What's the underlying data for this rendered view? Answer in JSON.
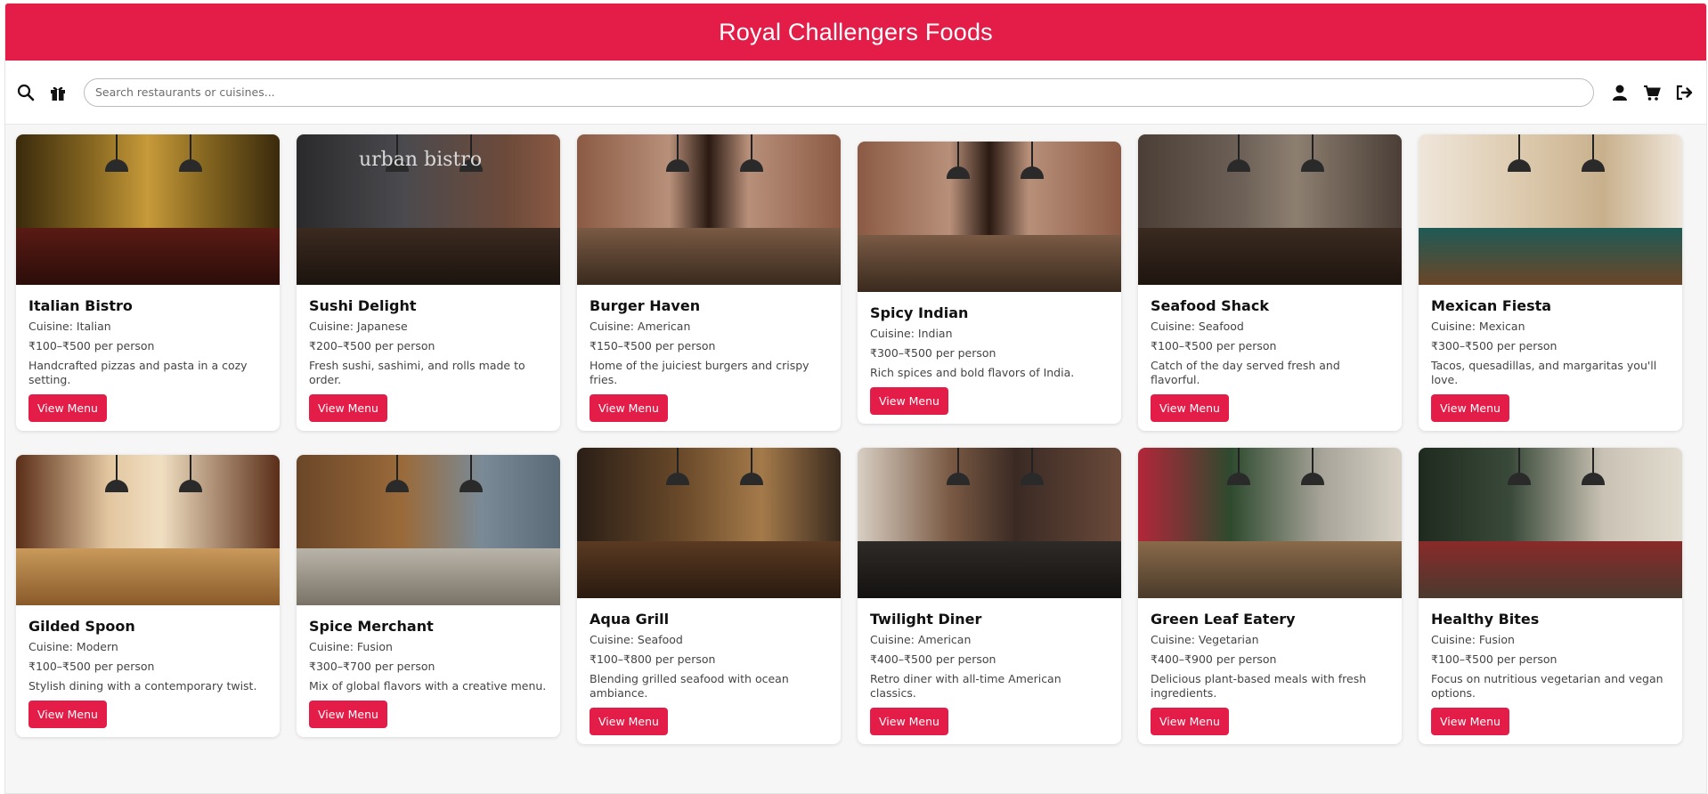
{
  "header": {
    "title": "Royal Challengers Foods"
  },
  "toolbar": {
    "left_icons": [
      "search-icon",
      "gift-icon"
    ],
    "search_placeholder": "Search restaurants or cuisines...",
    "search_value": "",
    "right_icons": [
      "user-icon",
      "cart-icon",
      "logout-icon"
    ]
  },
  "colors": {
    "brand": "#e31c48",
    "page_bg": "#f6f6f6",
    "card_bg": "#ffffff"
  },
  "restaurants": [
    {
      "name": "Italian Bistro",
      "cuisine": "Cuisine: Italian",
      "price": "₹100–₹500 per person",
      "description": "Handcrafted pizzas and pasta in a cozy setting.",
      "button": "View Menu",
      "photo_theme": "gold-chandelier-hall"
    },
    {
      "name": "Sushi Delight",
      "cuisine": "Cuisine: Japanese",
      "price": "₹200–₹500 per person",
      "description": "Fresh sushi, sashimi, and rolls made to order.",
      "button": "View Menu",
      "photo_theme": "urban-bistro-brick",
      "photo_sign": "urban bistro"
    },
    {
      "name": "Burger Haven",
      "cuisine": "Cuisine: American",
      "price": "₹150–₹500 per person",
      "description": "Home of the juiciest burgers and crispy fries.",
      "button": "View Menu",
      "photo_theme": "brick-fireplace"
    },
    {
      "name": "Spicy Indian",
      "cuisine": "Cuisine: Indian",
      "price": "₹300–₹500 per person",
      "description": "Rich spices and bold flavors of India.",
      "button": "View Menu",
      "photo_theme": "brick-fireplace"
    },
    {
      "name": "Seafood Shack",
      "cuisine": "Cuisine: Seafood",
      "price": "₹100–₹500 per person",
      "description": "Catch of the day served fresh and flavorful.",
      "button": "View Menu",
      "photo_theme": "stone-dining-room"
    },
    {
      "name": "Mexican Fiesta",
      "cuisine": "Cuisine: Mexican",
      "price": "₹300–₹500 per person",
      "description": "Tacos, quesadillas, and margaritas you'll love.",
      "button": "View Menu",
      "photo_theme": "teal-kitchen"
    },
    {
      "name": "Gilded Spoon",
      "cuisine": "Cuisine: Modern",
      "price": "₹100–₹500 per person",
      "description": "Stylish dining with a contemporary twist.",
      "button": "View Menu",
      "photo_theme": "rustic-kitchen"
    },
    {
      "name": "Spice Merchant",
      "cuisine": "Cuisine: Fusion",
      "price": "₹300–₹700 per person",
      "description": "Mix of global flavors with a creative menu.",
      "button": "View Menu",
      "photo_theme": "tiled-bar"
    },
    {
      "name": "Aqua Grill",
      "cuisine": "Cuisine: Seafood",
      "price": "₹100–₹800 per person",
      "description": "Blending grilled seafood with ocean ambiance.",
      "button": "View Menu",
      "photo_theme": "long-wood-bar"
    },
    {
      "name": "Twilight Diner",
      "cuisine": "Cuisine: American",
      "price": "₹400–₹500 per person",
      "description": "Retro diner with all-time American classics.",
      "button": "View Menu",
      "photo_theme": "diner-bar-stools"
    },
    {
      "name": "Green Leaf Eatery",
      "cuisine": "Cuisine: Vegetarian",
      "price": "₹400–₹900 per person",
      "description": "Delicious plant-based meals with fresh ingredients.",
      "button": "View Menu",
      "photo_theme": "street-cafe"
    },
    {
      "name": "Healthy Bites",
      "cuisine": "Cuisine: Fusion",
      "price": "₹100–₹500 per person",
      "description": "Focus on nutritious vegetarian and vegan options.",
      "button": "View Menu",
      "photo_theme": "parisian-terrace"
    }
  ]
}
